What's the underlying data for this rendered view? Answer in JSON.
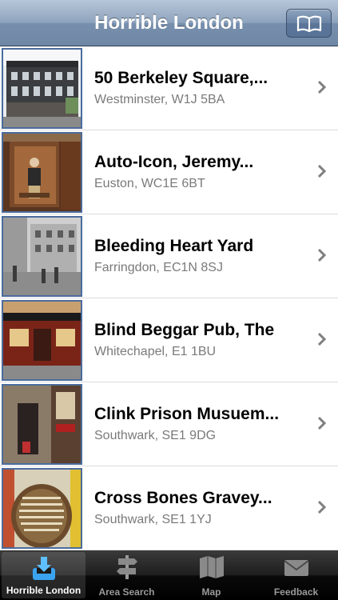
{
  "navbar": {
    "title": "Horrible London",
    "right_button_icon": "book-icon"
  },
  "colors": {
    "nav": "#7890ad",
    "thumb_border": "#4b6c9c",
    "active_tab_icon": "#3aa3f0"
  },
  "list": {
    "items": [
      {
        "title": "50 Berkeley Square,...",
        "subtitle": "Westminster, W1J 5BA"
      },
      {
        "title": "Auto-Icon, Jeremy...",
        "subtitle": "Euston, WC1E 6BT"
      },
      {
        "title": "Bleeding Heart Yard",
        "subtitle": "Farringdon, EC1N 8SJ"
      },
      {
        "title": "Blind Beggar Pub, The",
        "subtitle": "Whitechapel, E1 1BU"
      },
      {
        "title": "Clink Prison Musuem...",
        "subtitle": "Southwark, SE1 9DG"
      },
      {
        "title": "Cross Bones Gravey...",
        "subtitle": "Southwark, SE1 1YJ"
      }
    ]
  },
  "tabs": [
    {
      "label": "Horrible London",
      "icon": "download-tray-icon",
      "active": true
    },
    {
      "label": "Area Search",
      "icon": "signpost-icon",
      "active": false
    },
    {
      "label": "Map",
      "icon": "map-icon",
      "active": false
    },
    {
      "label": "Feedback",
      "icon": "envelope-icon",
      "active": false
    }
  ]
}
